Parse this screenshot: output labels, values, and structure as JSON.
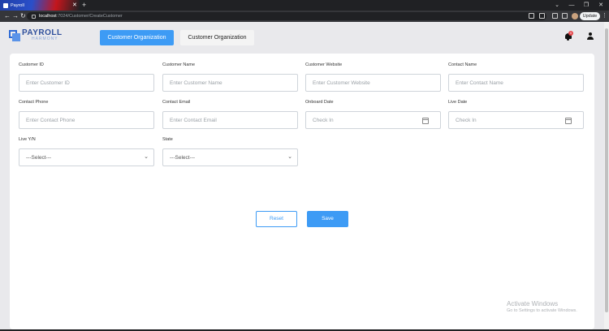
{
  "browser": {
    "tab_title": "Payroll",
    "tab_close": "✕",
    "new_tab": "+",
    "url_host": "localhost",
    "url_path": ":7024/Customer/CreateCustomer",
    "update_label": "Update",
    "window_controls": [
      "⌄",
      "—",
      "❐",
      "✕"
    ],
    "nav": {
      "back": "←",
      "forward": "→",
      "reload": "↻"
    },
    "menu_dots": "⋮"
  },
  "header": {
    "logo_brand": "PAYROLL",
    "logo_sub": "HARMONY",
    "tabs": [
      {
        "label": "Customer Organization",
        "active": true
      },
      {
        "label": "Customer Organization",
        "active": false
      }
    ],
    "notification_count": "0",
    "icons": [
      "bell-icon",
      "user-icon"
    ]
  },
  "form": {
    "fields": [
      {
        "label": "Customer ID",
        "placeholder": "Enter Customer ID"
      },
      {
        "label": "Customer Name",
        "placeholder": "Enter Customer Name"
      },
      {
        "label": "Customer Website",
        "placeholder": "Enter Customer Website"
      },
      {
        "label": "Contact Name",
        "placeholder": "Enter Contact Name"
      },
      {
        "label": "Contact Phone",
        "placeholder": "Enter Contact Phone"
      },
      {
        "label": "Contact Email",
        "placeholder": "Enter Contact Email"
      },
      {
        "label": "Onboard Date",
        "placeholder": "Check In"
      },
      {
        "label": "Live Date",
        "placeholder": "Check In"
      },
      {
        "label": "Live Y/N",
        "value": "---Select---"
      },
      {
        "label": "State",
        "value": "---Select---"
      }
    ],
    "reset_label": "Reset",
    "save_label": "Save"
  },
  "watermark": {
    "line1": "Activate Windows",
    "line2": "Go to Settings to activate Windows."
  },
  "colors": {
    "accent": "#3d9bf5",
    "badge": "#e5484d",
    "brand": "#2f4f9c"
  }
}
